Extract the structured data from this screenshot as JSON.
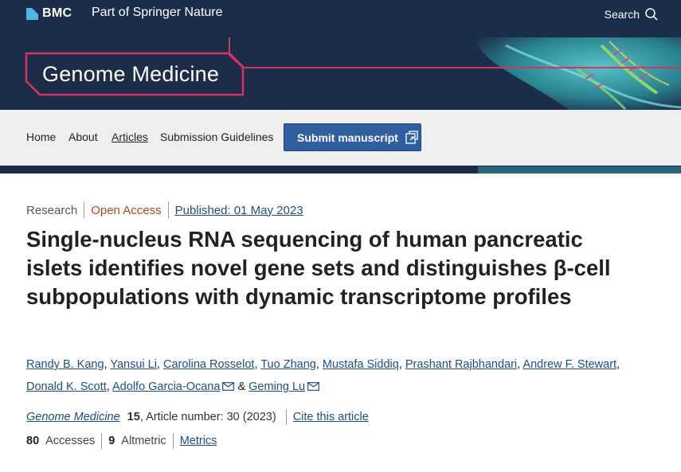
{
  "header": {
    "brand": "BMC",
    "tagline": "Part of Springer Nature",
    "search_label": "Search"
  },
  "banner": {
    "journal_title": "Genome Medicine"
  },
  "nav": {
    "items": [
      "Home",
      "About",
      "Articles",
      "Submission Guidelines"
    ],
    "active": "Articles",
    "submit_label": "Submit manuscript"
  },
  "article": {
    "type": "Research",
    "access": "Open Access",
    "published": "Published: 01 May 2023",
    "title": "Single-nucleus RNA sequencing of human pancreatic islets identifies novel gene sets and distinguishes β-cell subpopulations with dynamic transcriptome profiles",
    "authors": [
      "Randy B. Kang",
      "Yansui Li",
      "Carolina Rosselot",
      "Tuo Zhang",
      "Mustafa Siddiq",
      "Prashant Rajbhandari",
      "Andrew F. Stewart",
      "Donald K. Scott",
      "Adolfo Garcia-Ocana",
      "Geming Lu"
    ],
    "author_separator": "&",
    "journal": "Genome Medicine",
    "volume": "15",
    "article_number": ", Article number: 30 (2023)",
    "cite_label": "Cite this article",
    "accesses_count": "80",
    "accesses_label": "Accesses",
    "altmetric_count": "9",
    "altmetric_label": "Altmetric",
    "metrics_label": "Metrics"
  },
  "colors": {
    "header_bg": "#1c2d4a",
    "accent_pink": "#d8345f",
    "link": "#1d4e89",
    "open_access": "#b5481a",
    "button": "#2f5f9e"
  }
}
